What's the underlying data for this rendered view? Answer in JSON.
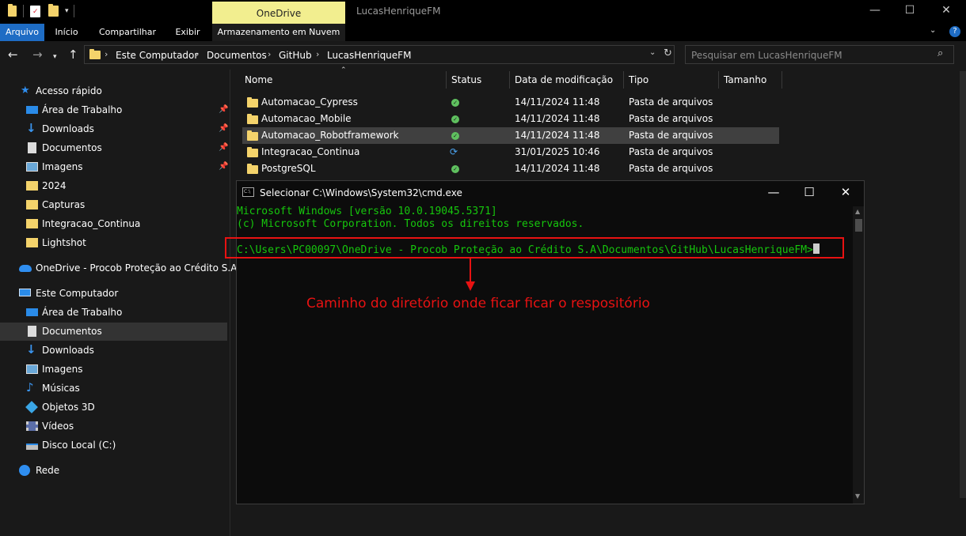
{
  "window": {
    "title": "LucasHenriqueFM",
    "context_tab": "OneDrive",
    "controls": {
      "minimize": "—",
      "maximize": "☐",
      "close": "✕"
    }
  },
  "ribbon": {
    "tabs": [
      "Arquivo",
      "Início",
      "Compartilhar",
      "Exibir",
      "Armazenamento em Nuvem"
    ]
  },
  "address": {
    "breadcrumbs": [
      "Este Computador",
      "Documentos",
      "GitHub",
      "LucasHenriqueFM"
    ],
    "search_placeholder": "Pesquisar em LucasHenriqueFM"
  },
  "nav": {
    "quick_access": "Acesso rápido",
    "quick_items": [
      {
        "label": "Área de Trabalho",
        "icon": "desktop-icon",
        "pinned": true
      },
      {
        "label": "Downloads",
        "icon": "download-icon",
        "pinned": true
      },
      {
        "label": "Documentos",
        "icon": "document-icon",
        "pinned": true
      },
      {
        "label": "Imagens",
        "icon": "image-icon",
        "pinned": true
      },
      {
        "label": "2024",
        "icon": "folder-icon",
        "pinned": false
      },
      {
        "label": "Capturas",
        "icon": "folder-icon",
        "pinned": false
      },
      {
        "label": "Integracao_Continua",
        "icon": "folder-icon",
        "pinned": false
      },
      {
        "label": "Lightshot",
        "icon": "folder-icon",
        "pinned": false
      }
    ],
    "onedrive": "OneDrive - Procob Proteção ao Crédito S.A",
    "this_pc": "Este Computador",
    "pc_items": [
      {
        "label": "Área de Trabalho",
        "icon": "desktop-icon"
      },
      {
        "label": "Documentos",
        "icon": "document-icon",
        "selected": true
      },
      {
        "label": "Downloads",
        "icon": "download-icon"
      },
      {
        "label": "Imagens",
        "icon": "image-icon"
      },
      {
        "label": "Músicas",
        "icon": "music-icon"
      },
      {
        "label": "Objetos 3D",
        "icon": "cube-icon"
      },
      {
        "label": "Vídeos",
        "icon": "video-icon"
      },
      {
        "label": "Disco Local (C:)",
        "icon": "drive-icon"
      }
    ],
    "network": "Rede"
  },
  "files": {
    "columns": [
      "Nome",
      "Status",
      "Data de modificação",
      "Tipo",
      "Tamanho"
    ],
    "rows": [
      {
        "name": "Automacao_Cypress",
        "status": "synced",
        "date": "14/11/2024 11:48",
        "type": "Pasta de arquivos"
      },
      {
        "name": "Automacao_Mobile",
        "status": "synced",
        "date": "14/11/2024 11:48",
        "type": "Pasta de arquivos"
      },
      {
        "name": "Automacao_Robotframework",
        "status": "synced",
        "date": "14/11/2024 11:48",
        "type": "Pasta de arquivos",
        "highlighted": true
      },
      {
        "name": "Integracao_Continua",
        "status": "syncing",
        "date": "31/01/2025 10:46",
        "type": "Pasta de arquivos"
      },
      {
        "name": "PostgreSQL",
        "status": "synced",
        "date": "14/11/2024 11:48",
        "type": "Pasta de arquivos"
      }
    ]
  },
  "cmd": {
    "title": "Selecionar C:\\Windows\\System32\\cmd.exe",
    "icon_text": "C:\\",
    "lines": [
      "Microsoft Windows [versão 10.0.19045.5371]",
      "(c) Microsoft Corporation. Todos os direitos reservados."
    ],
    "prompt": "C:\\Users\\PC00097\\OneDrive - Procob Proteção ao Crédito S.A\\Documentos\\GitHub\\LucasHenriqueFM>"
  },
  "annotation": {
    "text": "Caminho do diretório onde ficar ficar o respositório",
    "color": "#e81212"
  },
  "colors": {
    "accent": "#1e6cc4",
    "context_tab": "#f2ee8f",
    "terminal_text": "#16c60c",
    "folder": "#f4d36b"
  }
}
